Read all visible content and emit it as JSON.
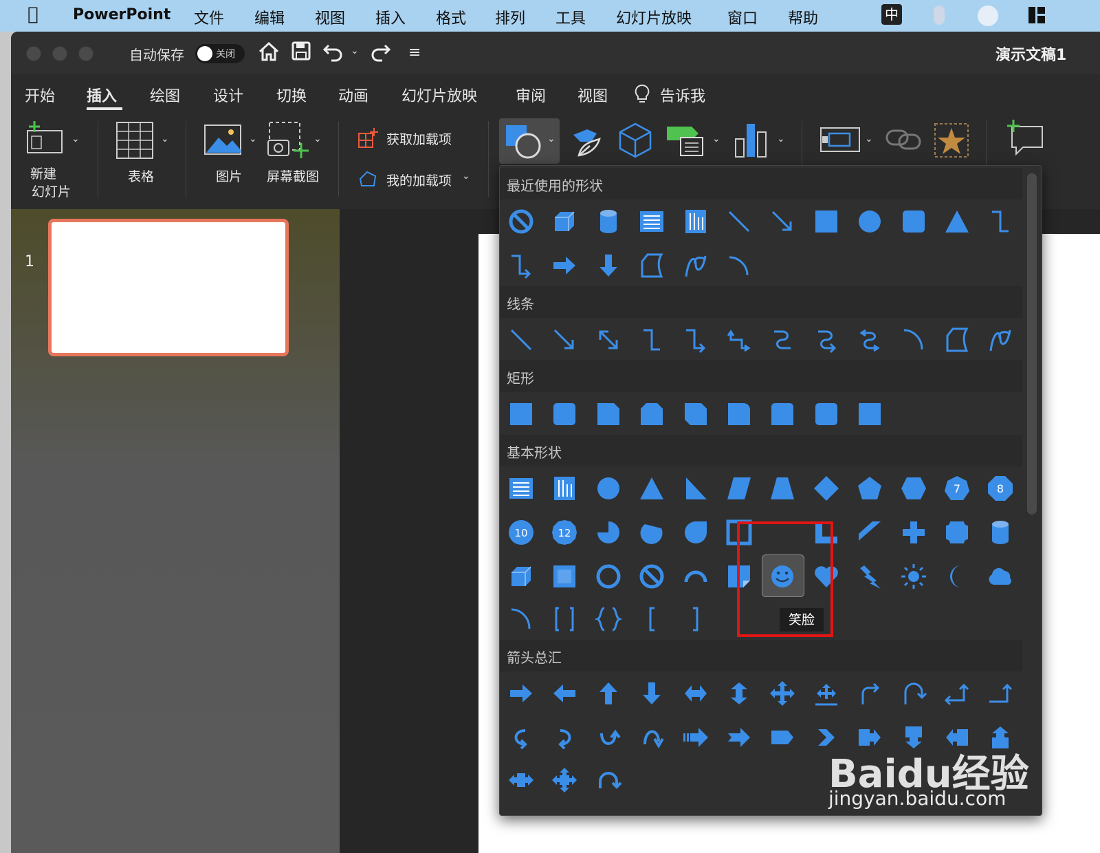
{
  "menubar": {
    "app": "PowerPoint",
    "items": [
      "文件",
      "编辑",
      "视图",
      "插入",
      "格式",
      "排列",
      "工具",
      "幻灯片放映",
      "窗口",
      "帮助"
    ],
    "input_method": "中"
  },
  "titlebar": {
    "autosave_label": "自动保存",
    "autosave_state": "关闭",
    "doc_title": "演示文稿1"
  },
  "tabs": [
    "开始",
    "插入",
    "绘图",
    "设计",
    "切换",
    "动画",
    "幻灯片放映",
    "审阅",
    "视图",
    "告诉我"
  ],
  "active_tab": "插入",
  "ribbon": {
    "new_slide": "新建\n幻灯片",
    "new_slide_l1": "新建",
    "new_slide_l2": "幻灯片",
    "table": "表格",
    "picture": "图片",
    "screenshot": "屏幕截图",
    "get_addins": "获取加载项",
    "my_addins": "我的加载项"
  },
  "thumbnail": {
    "number": "1"
  },
  "gallery": {
    "sections": {
      "recent": "最近使用的形状",
      "lines": "线条",
      "rectangles": "矩形",
      "basic": "基本形状",
      "arrows": "箭头总汇"
    },
    "tooltip": "笑脸",
    "hovered": "smiley-face"
  },
  "watermark": {
    "brand": "Bai",
    "brand2": "du",
    "brand3": "经验",
    "url": "jingyan.baidu.com"
  },
  "colors": {
    "accent": "#3b8ee8",
    "highlight": "#e01515",
    "thumb_border": "#e8765c"
  }
}
